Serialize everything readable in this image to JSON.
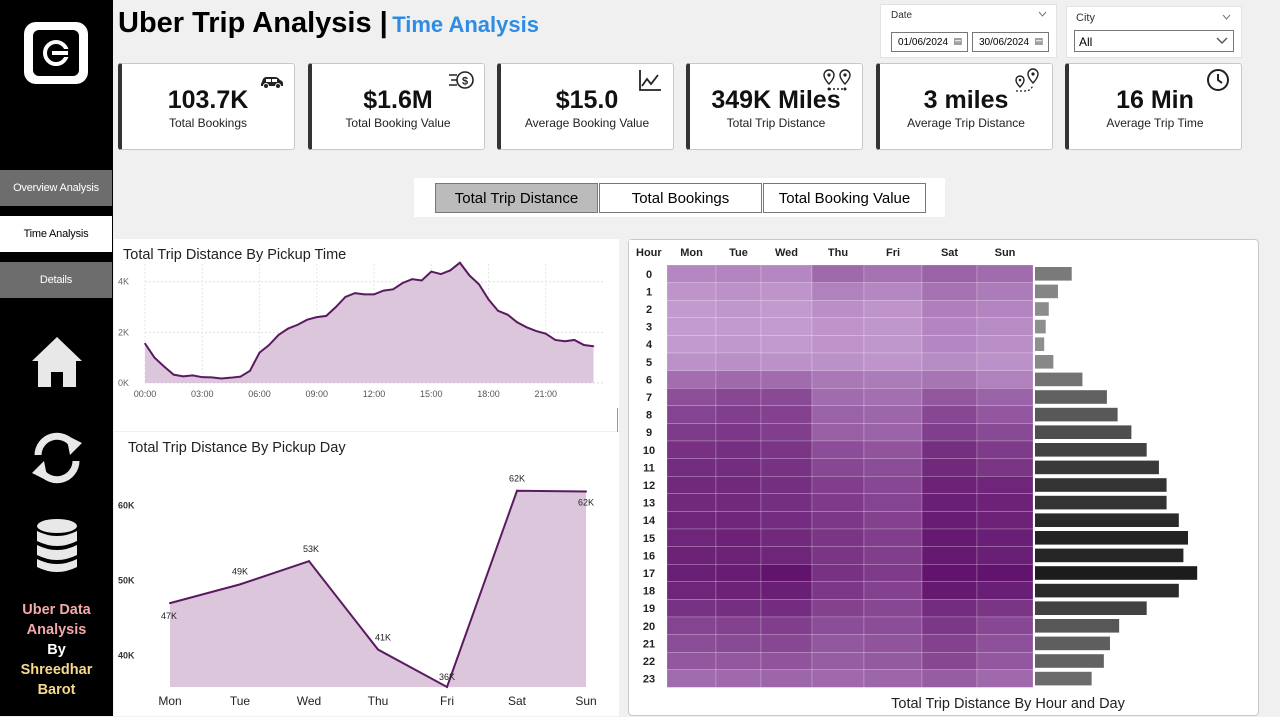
{
  "sidebar": {
    "nav": [
      "Overview Analysis",
      "Time Analysis",
      "Details"
    ],
    "active_nav": "Time Analysis",
    "icons": [
      "uber-logo-icon",
      "home-icon",
      "refresh-icon",
      "database-icon"
    ],
    "credit": [
      "Uber Data",
      "Analysis",
      "By",
      "Shreedhar",
      "Barot"
    ]
  },
  "header": {
    "title": "Uber Trip Analysis |",
    "subtitle": "Time Analysis"
  },
  "filters": {
    "date_label": "Date",
    "date_from": "01/06/2024",
    "date_to": "30/06/2024",
    "city_label": "City",
    "city_value": "All"
  },
  "kpis": [
    {
      "value": "103.7K",
      "label": "Total Bookings",
      "icon": "car-icon"
    },
    {
      "value": "$1.6M",
      "label": "Total Booking Value",
      "icon": "money-icon"
    },
    {
      "value": "$15.0",
      "label": "Average Booking Value",
      "icon": "line-chart-icon"
    },
    {
      "value": "349K Miles",
      "label": "Total Trip Distance",
      "icon": "route-pins-icon"
    },
    {
      "value": "3 miles",
      "label": "Average Trip Distance",
      "icon": "route-pin-icon"
    },
    {
      "value": "16 Min",
      "label": "Average Trip Time",
      "icon": "clock-icon"
    }
  ],
  "metric_toggle": {
    "options": [
      "Total Trip Distance",
      "Total Bookings",
      "Total Booking Value"
    ],
    "active": "Total Trip Distance"
  },
  "colors": {
    "accent": "#2e8ce5",
    "line": "#5a1a60",
    "area": "#dcc6dc",
    "heat_low": "#c9a3d6",
    "heat_high": "#5b0a66"
  },
  "chart_data": [
    {
      "type": "area",
      "title": "Total Trip Distance By Pickup Time",
      "x_ticks": [
        "00:00",
        "03:00",
        "06:00",
        "09:00",
        "12:00",
        "15:00",
        "18:00",
        "21:00"
      ],
      "y_ticks": [
        "0K",
        "2K",
        "4K"
      ],
      "ylim": [
        0,
        4700
      ],
      "x_range_hours": [
        0,
        24
      ],
      "x_values_hours": [
        0,
        0.5,
        1,
        1.5,
        2,
        2.5,
        3,
        3.5,
        4,
        4.5,
        5,
        5.5,
        6,
        6.5,
        7,
        7.5,
        8,
        8.5,
        9,
        9.5,
        10,
        10.5,
        11,
        11.5,
        12,
        12.5,
        13,
        13.5,
        14,
        14.5,
        15,
        15.5,
        16,
        16.5,
        17,
        17.5,
        18,
        18.5,
        19,
        19.5,
        20,
        20.5,
        21,
        21.5,
        22,
        22.5,
        23,
        23.5
      ],
      "values": [
        1560,
        1000,
        650,
        330,
        260,
        300,
        230,
        220,
        180,
        210,
        250,
        480,
        1200,
        1500,
        1900,
        2150,
        2300,
        2500,
        2600,
        2650,
        3000,
        3400,
        3550,
        3500,
        3500,
        3650,
        3700,
        3950,
        4100,
        4050,
        4400,
        4300,
        4450,
        4750,
        4250,
        3900,
        3300,
        2850,
        2700,
        2400,
        2200,
        2050,
        1950,
        1700,
        1650,
        1700,
        1500,
        1450
      ]
    },
    {
      "type": "area",
      "title": "Total Trip Distance By Pickup Day",
      "categories": [
        "Mon",
        "Tue",
        "Wed",
        "Thu",
        "Fri",
        "Sat",
        "Sun"
      ],
      "values": [
        47,
        49.5,
        52.6,
        40.8,
        35.8,
        62,
        61.9
      ],
      "data_labels": [
        "47K",
        "49K",
        "53K",
        "41K",
        "36K",
        "62K",
        "62K"
      ],
      "y_ticks": [
        {
          "v": 40,
          "label": "40K"
        },
        {
          "v": 50,
          "label": "50K"
        },
        {
          "v": 60,
          "label": "60K"
        }
      ],
      "ylim": [
        35.8,
        62.5
      ]
    },
    {
      "type": "heatmap",
      "title": "Total Trip Distance By Hour and Day",
      "row_header": "Hour",
      "columns": [
        "Mon",
        "Tue",
        "Wed",
        "Thu",
        "Fri",
        "Sat",
        "Sun"
      ],
      "rows": [
        "0",
        "1",
        "2",
        "3",
        "4",
        "5",
        "6",
        "7",
        "8",
        "9",
        "10",
        "11",
        "12",
        "13",
        "14",
        "15",
        "16",
        "17",
        "18",
        "19",
        "20",
        "21",
        "22",
        "23"
      ],
      "intensity": [
        [
          0.18,
          0.2,
          0.18,
          0.38,
          0.32,
          0.42,
          0.36
        ],
        [
          0.1,
          0.12,
          0.1,
          0.22,
          0.18,
          0.32,
          0.26
        ],
        [
          0.06,
          0.08,
          0.06,
          0.14,
          0.1,
          0.24,
          0.2
        ],
        [
          0.05,
          0.06,
          0.05,
          0.1,
          0.08,
          0.2,
          0.16
        ],
        [
          0.06,
          0.07,
          0.06,
          0.1,
          0.08,
          0.18,
          0.14
        ],
        [
          0.12,
          0.14,
          0.12,
          0.12,
          0.1,
          0.16,
          0.12
        ],
        [
          0.35,
          0.38,
          0.36,
          0.28,
          0.26,
          0.3,
          0.22
        ],
        [
          0.55,
          0.6,
          0.58,
          0.36,
          0.34,
          0.5,
          0.42
        ],
        [
          0.62,
          0.66,
          0.64,
          0.42,
          0.4,
          0.6,
          0.5
        ],
        [
          0.68,
          0.7,
          0.66,
          0.44,
          0.42,
          0.66,
          0.58
        ],
        [
          0.75,
          0.76,
          0.72,
          0.56,
          0.52,
          0.76,
          0.68
        ],
        [
          0.78,
          0.78,
          0.74,
          0.6,
          0.56,
          0.8,
          0.72
        ],
        [
          0.8,
          0.8,
          0.76,
          0.66,
          0.6,
          0.84,
          0.82
        ],
        [
          0.8,
          0.8,
          0.76,
          0.68,
          0.62,
          0.86,
          0.84
        ],
        [
          0.82,
          0.82,
          0.78,
          0.7,
          0.64,
          0.88,
          0.84
        ],
        [
          0.82,
          0.84,
          0.8,
          0.72,
          0.66,
          0.9,
          0.86
        ],
        [
          0.84,
          0.84,
          0.82,
          0.72,
          0.66,
          0.9,
          0.86
        ],
        [
          0.86,
          0.88,
          0.94,
          0.74,
          0.68,
          0.94,
          0.94
        ],
        [
          0.82,
          0.84,
          0.86,
          0.7,
          0.64,
          0.9,
          0.86
        ],
        [
          0.74,
          0.76,
          0.78,
          0.64,
          0.6,
          0.78,
          0.72
        ],
        [
          0.62,
          0.64,
          0.66,
          0.56,
          0.56,
          0.7,
          0.6
        ],
        [
          0.56,
          0.58,
          0.6,
          0.5,
          0.52,
          0.64,
          0.54
        ],
        [
          0.5,
          0.5,
          0.52,
          0.46,
          0.48,
          0.6,
          0.5
        ],
        [
          0.36,
          0.38,
          0.4,
          0.38,
          0.4,
          0.46,
          0.38
        ]
      ],
      "row_totals_relative": [
        0.24,
        0.15,
        0.09,
        0.07,
        0.06,
        0.12,
        0.31,
        0.47,
        0.54,
        0.63,
        0.73,
        0.81,
        0.86,
        0.86,
        0.94,
        1.0,
        0.97,
        1.06,
        0.94,
        0.73,
        0.55,
        0.49,
        0.45,
        0.37
      ]
    }
  ]
}
